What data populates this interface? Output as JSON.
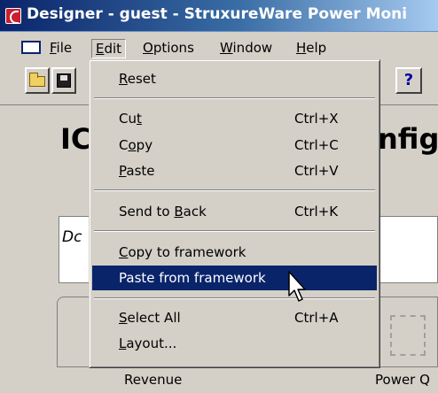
{
  "window": {
    "title": "Designer - guest - StruxureWare Power Moni"
  },
  "menubar": {
    "items": [
      {
        "label": "File",
        "mnemonic": "F",
        "rest": "ile"
      },
      {
        "label": "Edit",
        "mnemonic": "E",
        "rest": "dit"
      },
      {
        "label": "Options",
        "mnemonic": "O",
        "rest": "ptions"
      },
      {
        "label": "Window",
        "mnemonic": "W",
        "rest": "indow"
      },
      {
        "label": "Help",
        "mnemonic": "H",
        "rest": "elp"
      }
    ]
  },
  "toolbar": {
    "buttons": [
      {
        "icon": "open-folder-icon"
      },
      {
        "icon": "save-icon"
      },
      {
        "icon": "help-icon",
        "glyph": "?"
      }
    ]
  },
  "background": {
    "heading_left": "IC",
    "heading_right": "nfig",
    "text_box_value": "Dc",
    "panels": [
      {
        "label": "Revenue"
      },
      {
        "label": "Power Q"
      }
    ]
  },
  "edit_menu": {
    "items": [
      {
        "pre": "",
        "mn": "R",
        "post": "eset",
        "shortcut": ""
      },
      {
        "pre": "Cu",
        "mn": "t",
        "post": "",
        "shortcut": "Ctrl+X"
      },
      {
        "pre": "C",
        "mn": "o",
        "post": "py",
        "shortcut": "Ctrl+C"
      },
      {
        "pre": "",
        "mn": "P",
        "post": "aste",
        "shortcut": "Ctrl+V"
      },
      {
        "pre": "Send to ",
        "mn": "B",
        "post": "ack",
        "shortcut": "Ctrl+K"
      },
      {
        "pre": "",
        "mn": "C",
        "post": "opy to framework",
        "shortcut": ""
      },
      {
        "pre": "Paste from framework",
        "mn": "",
        "post": "",
        "shortcut": ""
      },
      {
        "pre": "",
        "mn": "S",
        "post": "elect All",
        "shortcut": "Ctrl+A"
      },
      {
        "pre": "",
        "mn": "L",
        "post": "ayout...",
        "shortcut": ""
      }
    ],
    "highlighted_index": 6
  },
  "colors": {
    "title_bar": "#0a246a",
    "highlight": "#0a246a",
    "face": "#d4d0c8"
  }
}
